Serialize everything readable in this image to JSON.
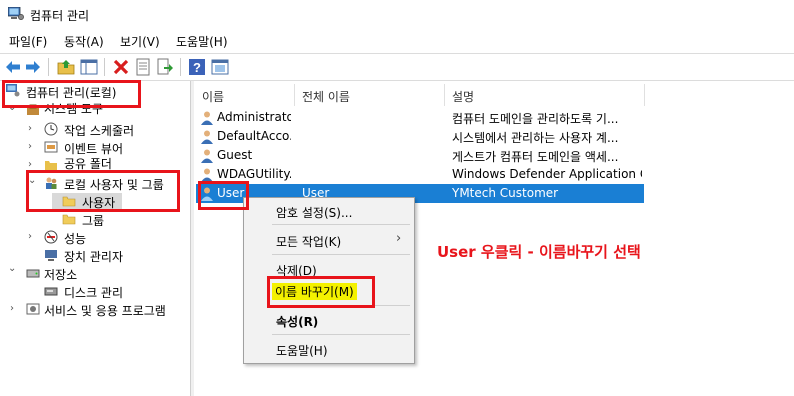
{
  "window": {
    "title": "컴퓨터 관리"
  },
  "menu": [
    "파일(F)",
    "동작(A)",
    "보기(V)",
    "도움말(H)"
  ],
  "toolbar_icons": [
    "back-icon",
    "forward-icon",
    "up-folder-icon",
    "show-hide-tree-icon",
    "delete-icon",
    "properties-icon",
    "export-icon",
    "help-icon",
    "view-icon"
  ],
  "tree": {
    "root": "컴퓨터 관리(로컬)",
    "system_tools": "시스템 도구",
    "task_scheduler": "작업 스케줄러",
    "event_viewer": "이벤트 뷰어",
    "shared_folders": "공유 폴더",
    "local_users_groups": "로컬 사용자 및 그룹",
    "users": "사용자",
    "groups": "그룹",
    "performance": "성능",
    "device_manager": "장치 관리자",
    "storage": "저장소",
    "disk_management": "디스크 관리",
    "services_apps": "서비스 및 응용 프로그램"
  },
  "columns": {
    "name": "이름",
    "full_name": "전체 이름",
    "description": "설명"
  },
  "users": [
    {
      "name": "Administrator",
      "full_name": "",
      "description": "컴퓨터 도메인을 관리하도록 기..."
    },
    {
      "name": "DefaultAcco...",
      "full_name": "",
      "description": "시스템에서 관리하는 사용자 계..."
    },
    {
      "name": "Guest",
      "full_name": "",
      "description": "게스트가 컴퓨터 도메인을 액세..."
    },
    {
      "name": "WDAGUtility...",
      "full_name": "",
      "description": "Windows Defender Application G..."
    },
    {
      "name": "User",
      "full_name": "User",
      "description": "YMtech Customer"
    }
  ],
  "context_menu": {
    "set_password": "암호 설정(S)...",
    "all_tasks": "모든 작업(K)",
    "delete": "삭제(D)",
    "rename": "이름 바꾸기(M)",
    "properties": "속성(R)",
    "help": "도움말(H)"
  },
  "annotation": "User 우클릭 - 이름바꾸기 선택",
  "colors": {
    "highlight_red": "#e8141b",
    "selection_blue": "#1a7fd4",
    "rename_highlight": "#f4f100"
  }
}
